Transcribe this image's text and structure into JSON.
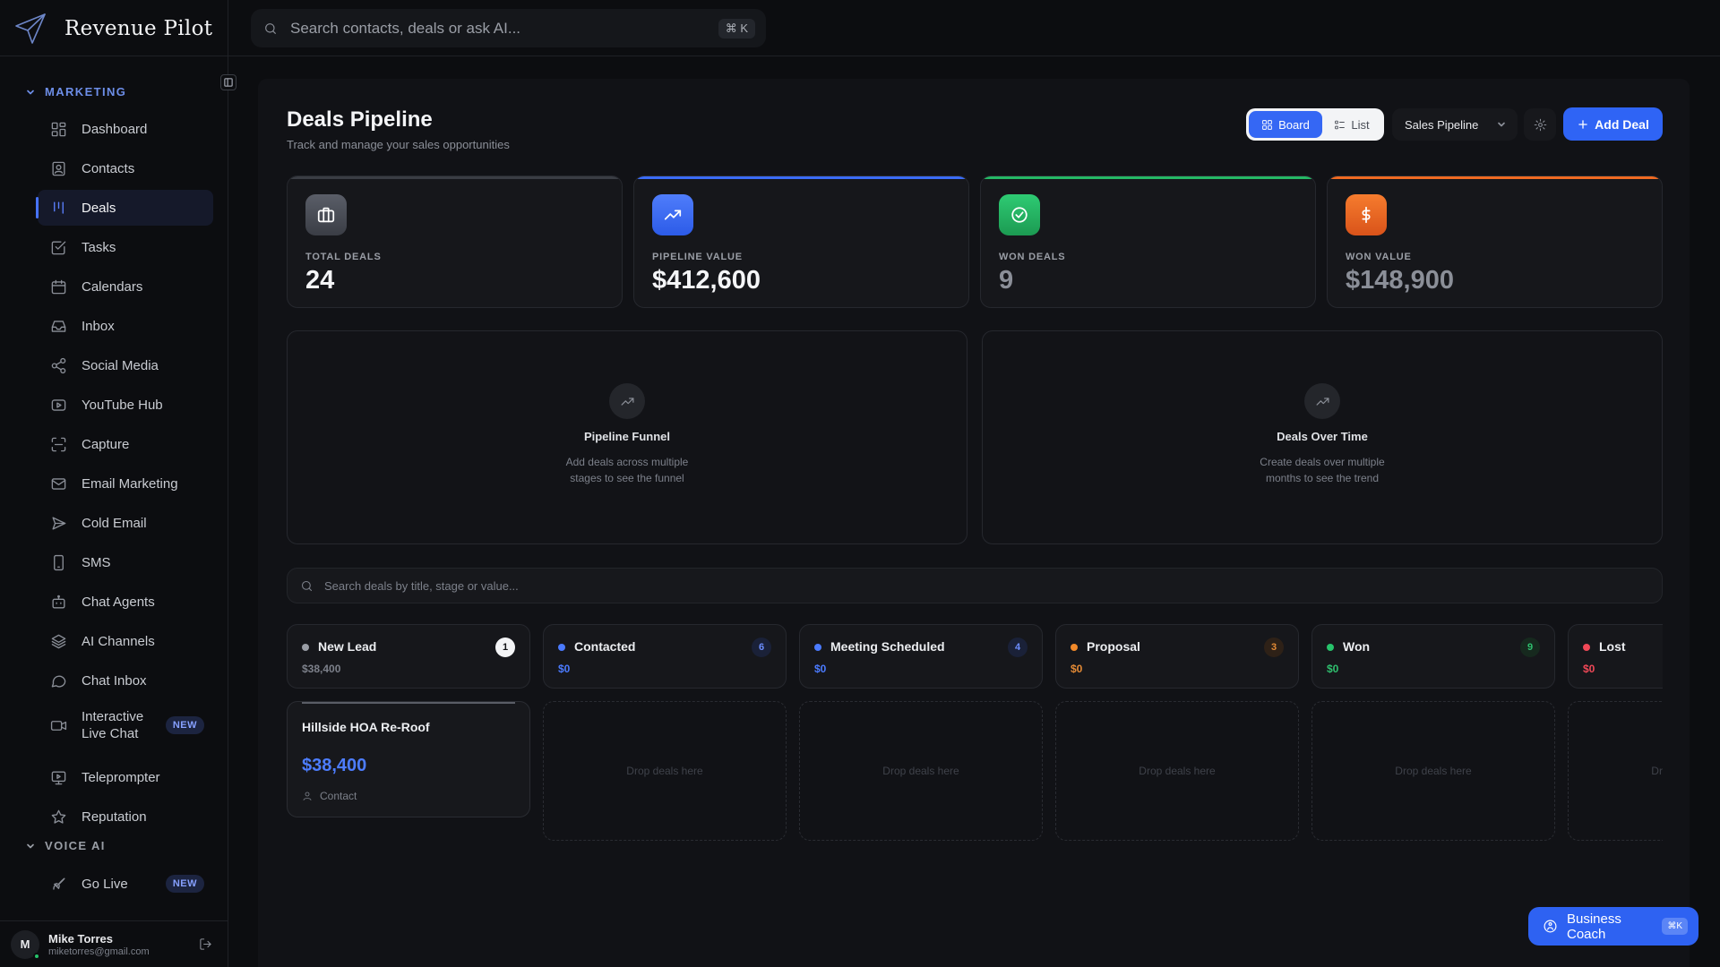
{
  "app": {
    "name": "Revenue Pilot"
  },
  "search": {
    "placeholder": "Search contacts, deals or ask AI...",
    "shortcut": "⌘ K"
  },
  "sidebar": {
    "sections": [
      {
        "label": "MARKETING",
        "color": "#6d8ee8"
      },
      {
        "label": "VOICE AI",
        "color": "#9a9ea6"
      }
    ],
    "items": [
      {
        "label": "Dashboard",
        "icon": "grid-icon"
      },
      {
        "label": "Contacts",
        "icon": "contact-book-icon"
      },
      {
        "label": "Deals",
        "icon": "kanban-icon",
        "active": true
      },
      {
        "label": "Tasks",
        "icon": "checkbox-icon"
      },
      {
        "label": "Calendars",
        "icon": "calendar-icon"
      },
      {
        "label": "Inbox",
        "icon": "inbox-icon"
      },
      {
        "label": "Social Media",
        "icon": "share-icon"
      },
      {
        "label": "YouTube Hub",
        "icon": "youtube-icon"
      },
      {
        "label": "Capture",
        "icon": "scan-icon"
      },
      {
        "label": "Email Marketing",
        "icon": "mail-icon"
      },
      {
        "label": "Cold Email",
        "icon": "send-icon"
      },
      {
        "label": "SMS",
        "icon": "phone-icon"
      },
      {
        "label": "Chat Agents",
        "icon": "bot-icon"
      },
      {
        "label": "AI Channels",
        "icon": "layers-icon"
      },
      {
        "label": "Chat Inbox",
        "icon": "chat-bubble-icon"
      },
      {
        "label": "Interactive Live Chat",
        "icon": "video-icon",
        "badge": "NEW"
      },
      {
        "label": "Teleprompter",
        "icon": "monitor-icon"
      },
      {
        "label": "Reputation",
        "icon": "star-icon"
      },
      {
        "label": "Go Live",
        "icon": "rocket-icon",
        "badge": "NEW"
      }
    ]
  },
  "user": {
    "initial": "M",
    "name": "Mike Torres",
    "email": "miketorres@gmail.com"
  },
  "page": {
    "title": "Deals Pipeline",
    "subtitle": "Track and manage your sales opportunities",
    "view_board": "Board",
    "view_list": "List",
    "pipeline": "Sales Pipeline",
    "add_deal": "Add Deal"
  },
  "stats": [
    {
      "label": "TOTAL DEALS",
      "value": "24",
      "accent": "#3a3d44",
      "icon": "briefcase-icon",
      "value_color": "#f4f5f7"
    },
    {
      "label": "PIPELINE VALUE",
      "value": "$412,600",
      "accent": "#3b6cf6",
      "icon": "trending-up-icon",
      "value_color": "#f4f5f7"
    },
    {
      "label": "WON DEALS",
      "value": "9",
      "accent": "#25b865",
      "icon": "check-circle-icon",
      "value_color": "#8b8f98"
    },
    {
      "label": "WON VALUE",
      "value": "$148,900",
      "accent": "#ef6a22",
      "icon": "dollar-icon",
      "value_color": "#8b8f98"
    }
  ],
  "charts": [
    {
      "title": "Pipeline Funnel",
      "desc": "Add deals across multiple stages to see the funnel"
    },
    {
      "title": "Deals Over Time",
      "desc": "Create deals over multiple months to see the trend"
    }
  ],
  "deal_search": {
    "placeholder": "Search deals by title, stage or value..."
  },
  "columns": [
    {
      "name": "New Lead",
      "count": "1",
      "total": "$38,400",
      "color": "#9a9ea6",
      "total_color": "#7c808a",
      "count_bg": "#f3f4f6",
      "count_color": "#111216"
    },
    {
      "name": "Contacted",
      "count": "6",
      "total": "$0",
      "color": "#4b7bff",
      "total_color": "#4b7bff",
      "count_bg": "#1a2138",
      "count_color": "#6d8eff"
    },
    {
      "name": "Meeting Scheduled",
      "count": "4",
      "total": "$0",
      "color": "#4b7bff",
      "total_color": "#4b7bff",
      "count_bg": "#1a2138",
      "count_color": "#6d8eff"
    },
    {
      "name": "Proposal",
      "count": "3",
      "total": "$0",
      "color": "#f28a2a",
      "total_color": "#e38a35",
      "count_bg": "#2e2117",
      "count_color": "#e38a35"
    },
    {
      "name": "Won",
      "count": "9",
      "total": "$0",
      "color": "#27c36b",
      "total_color": "#2fbf6e",
      "count_bg": "#16291e",
      "count_color": "#2fbf6e"
    },
    {
      "name": "Lost",
      "count": "",
      "total": "$0",
      "color": "#f04857",
      "total_color": "#f04857",
      "count_bg": "transparent",
      "count_color": "#f04857"
    }
  ],
  "drop_label": "Drop deals here",
  "deal": {
    "title": "Hillside HOA Re-Roof",
    "value": "$38,400",
    "contact": "Contact"
  },
  "coach": {
    "label": "Business Coach",
    "shortcut": "⌘K"
  }
}
